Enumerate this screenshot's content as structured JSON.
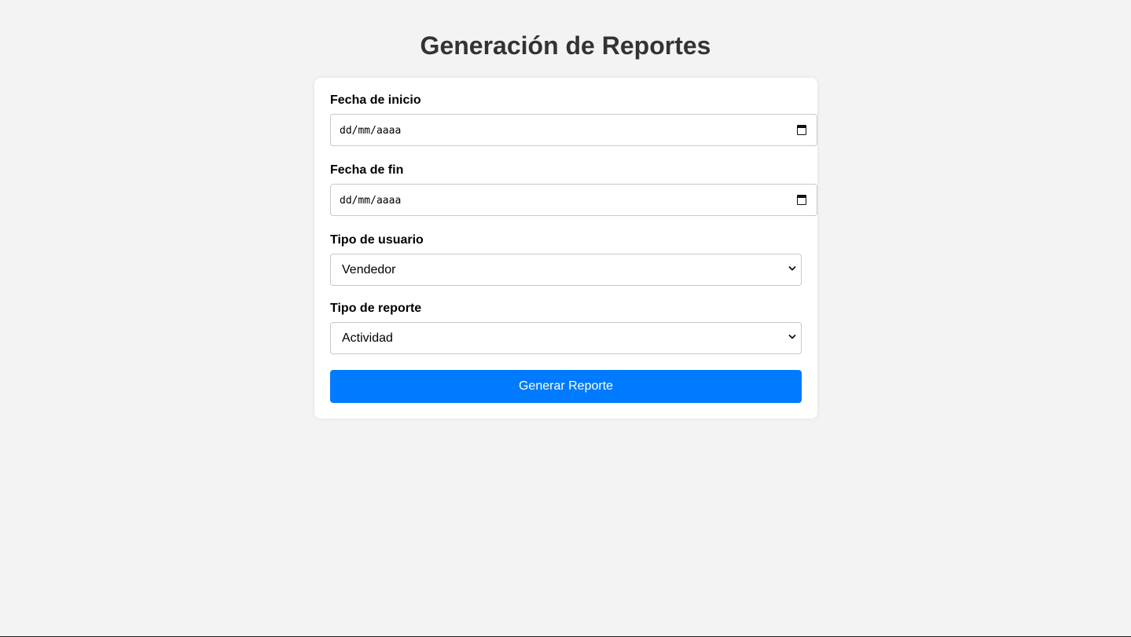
{
  "page": {
    "title": "Generación de Reportes"
  },
  "form": {
    "start_date": {
      "label": "Fecha de inicio",
      "placeholder": "dd/mm/aaaa"
    },
    "end_date": {
      "label": "Fecha de fin",
      "placeholder": "dd/mm/aaaa"
    },
    "user_type": {
      "label": "Tipo de usuario",
      "selected": "Vendedor"
    },
    "report_type": {
      "label": "Tipo de reporte",
      "selected": "Actividad"
    },
    "submit_label": "Generar Reporte"
  },
  "colors": {
    "background": "#f3f3f3",
    "card": "#ffffff",
    "accent": "#007bff",
    "title": "#333333"
  },
  "icons": {
    "date_picker": "calendar-icon",
    "select_arrow": "chevron-down-icon"
  }
}
